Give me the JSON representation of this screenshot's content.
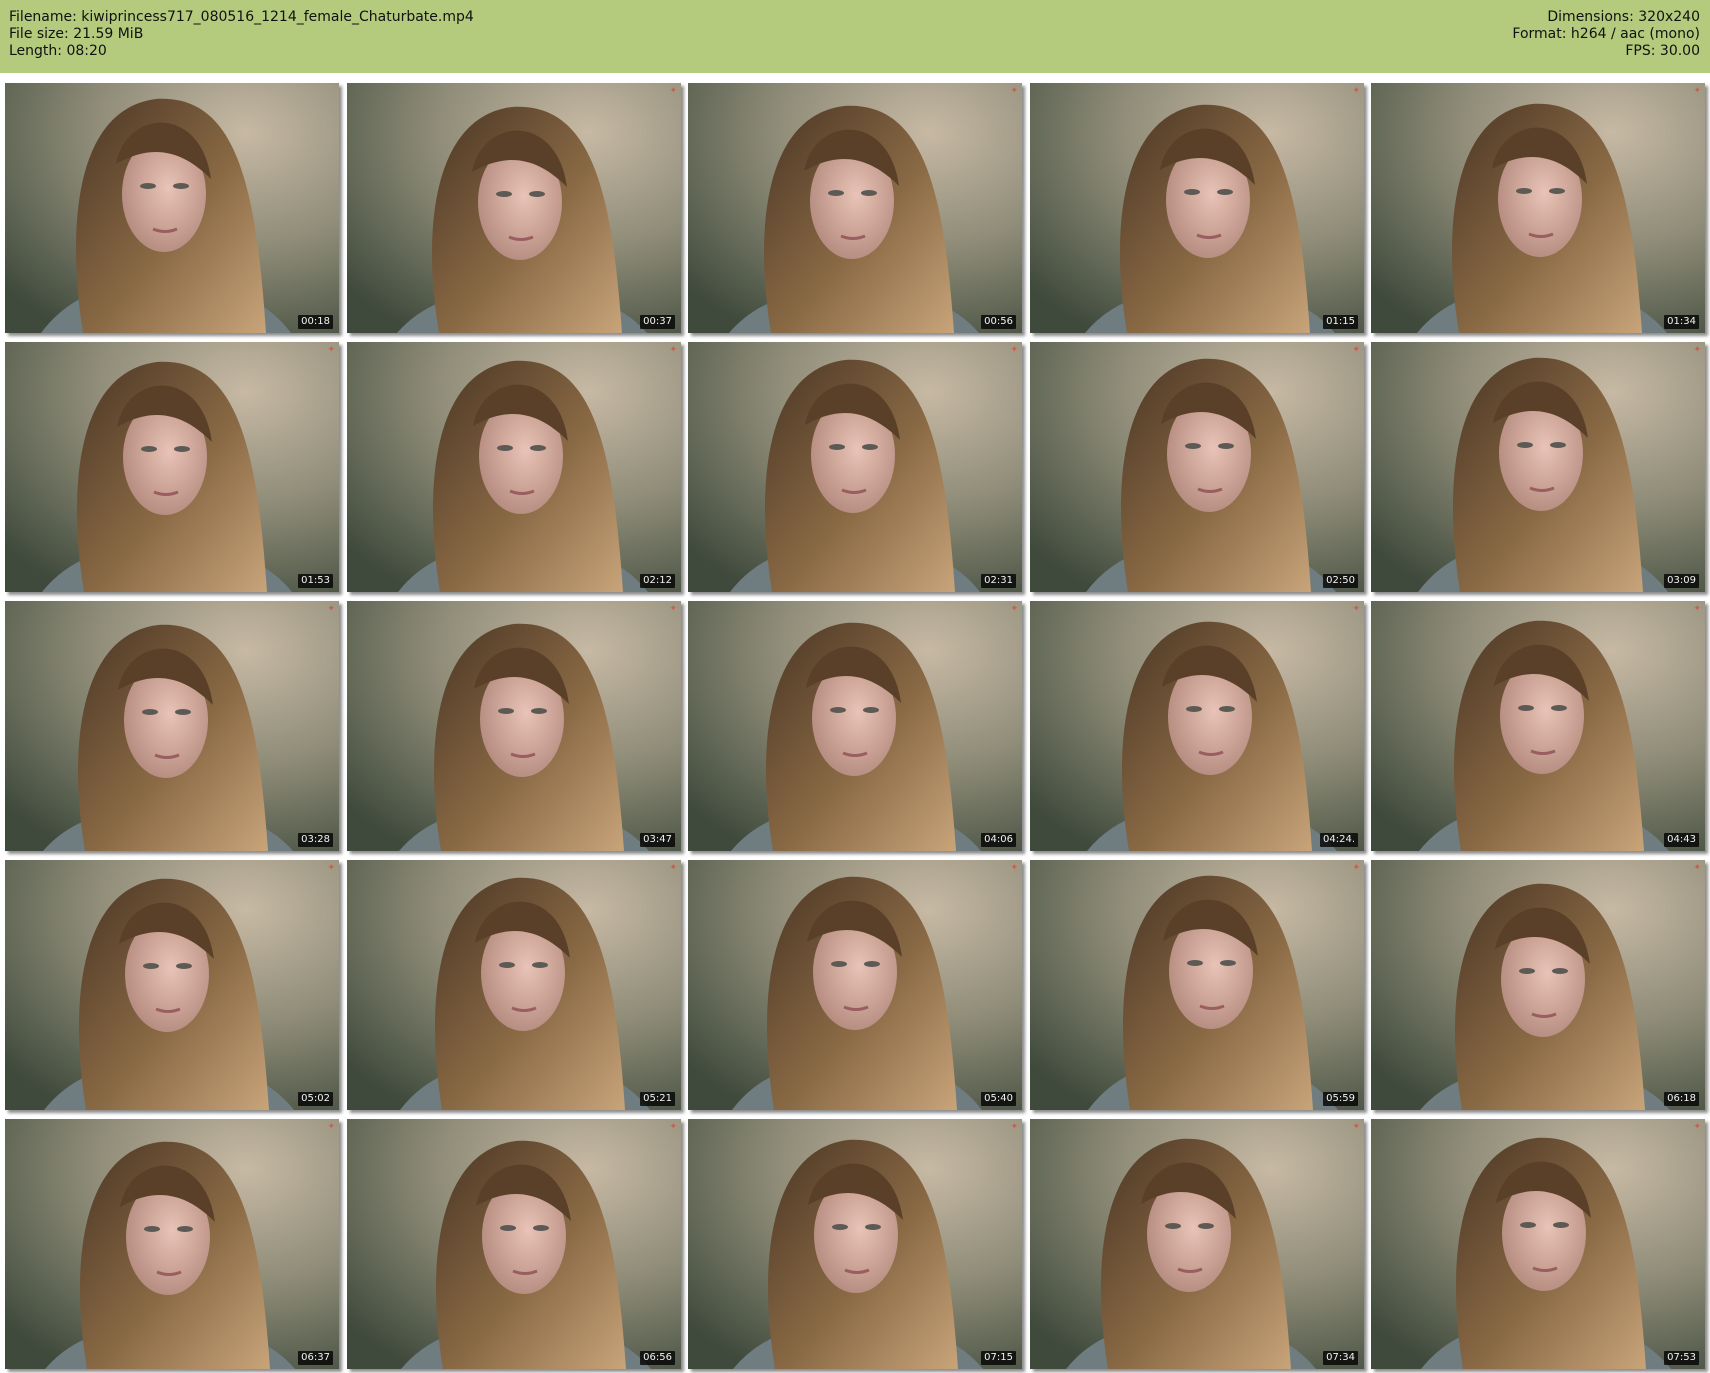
{
  "header": {
    "left": [
      "Filename: kiwiprincess717_080516_1214_female_Chaturbate.mp4",
      "File size: 21.59 MiB",
      "Length: 08:20"
    ],
    "right": [
      "Dimensions: 320x240",
      "Format: h264 / aac (mono)",
      "FPS: 30.00"
    ]
  },
  "colors": {
    "header_bg": "#b4cb7d",
    "timestamp_bg": "#000000",
    "watermark": "#dc463c"
  },
  "grid": {
    "columns": 5,
    "rows": 5
  },
  "thumbnails": [
    {
      "timestamp": "00:18"
    },
    {
      "timestamp": "00:37"
    },
    {
      "timestamp": "00:56"
    },
    {
      "timestamp": "01:15"
    },
    {
      "timestamp": "01:34"
    },
    {
      "timestamp": "01:53"
    },
    {
      "timestamp": "02:12"
    },
    {
      "timestamp": "02:31"
    },
    {
      "timestamp": "02:50"
    },
    {
      "timestamp": "03:09"
    },
    {
      "timestamp": "03:28"
    },
    {
      "timestamp": "03:47"
    },
    {
      "timestamp": "04:06"
    },
    {
      "timestamp": "04:24."
    },
    {
      "timestamp": "04:43"
    },
    {
      "timestamp": "05:02"
    },
    {
      "timestamp": "05:21"
    },
    {
      "timestamp": "05:40"
    },
    {
      "timestamp": "05:59"
    },
    {
      "timestamp": "06:18"
    },
    {
      "timestamp": "06:37"
    },
    {
      "timestamp": "06:56"
    },
    {
      "timestamp": "07:15"
    },
    {
      "timestamp": "07:34"
    },
    {
      "timestamp": "07:53"
    }
  ]
}
